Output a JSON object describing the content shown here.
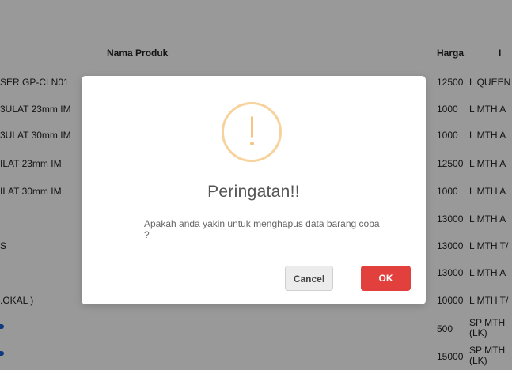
{
  "table": {
    "headers": {
      "nama_produk": "Nama Produk",
      "harga": "Harga",
      "extra": "I"
    },
    "left_cells": [
      "SER GP-CLN01",
      "3ULAT 23mm IM",
      "3ULAT 30mm IM",
      "ILAT 23mm IM",
      "ILAT 30mm IM",
      "",
      "S",
      "",
      ".OKAL )",
      "",
      ""
    ],
    "prices": [
      "12500",
      "1000",
      "1000",
      "12500",
      "1000",
      "13000",
      "13000",
      "13000",
      "10000",
      "500",
      "15000"
    ],
    "codes": [
      "L QUEEN",
      "L MTH A",
      "L MTH A",
      "L MTH A",
      "L MTH A",
      "L MTH A",
      "L MTH T/",
      "L MTH A",
      "L MTH T/",
      "SP MTH",
      "SP MTH"
    ],
    "code_suffix": [
      "",
      "",
      "",
      "",
      "",
      "",
      "",
      "",
      "",
      "(LK)",
      "(LK)"
    ]
  },
  "dialog": {
    "icon": "exclamation-icon",
    "title": "Peringatan!!",
    "message": "Apakah anda yakin untuk menghapus data barang coba ?",
    "cancel_label": "Cancel",
    "ok_label": "OK"
  },
  "colors": {
    "overlay": "rgba(0,0,0,0.40)",
    "warning": "#f8c384",
    "ok_button": "#e2403c",
    "cancel_button": "#ececec"
  }
}
